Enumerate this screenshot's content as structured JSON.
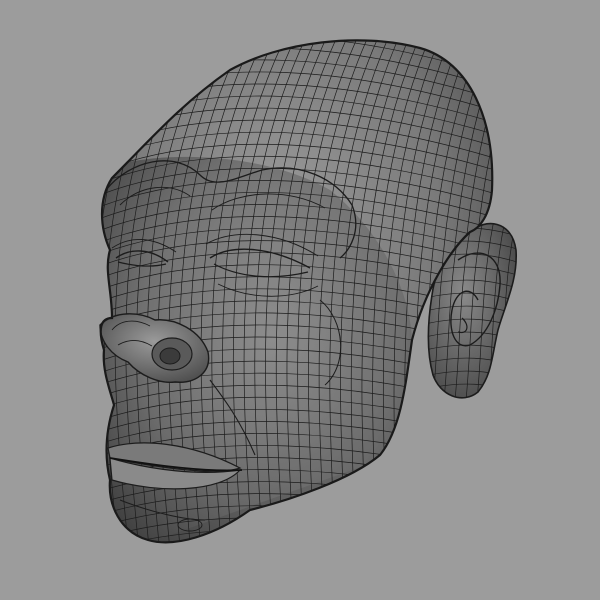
{
  "viewport": {
    "background_color": "#9c9c9c",
    "display_mode": "wireframe-on-shaded",
    "subject": "head-mesh"
  },
  "mesh": {
    "shade_light": "#9a9a9a",
    "shade_mid": "#6f6f6f",
    "shade_dark": "#3a3a3a",
    "wire_color": "#1c1c1c"
  }
}
